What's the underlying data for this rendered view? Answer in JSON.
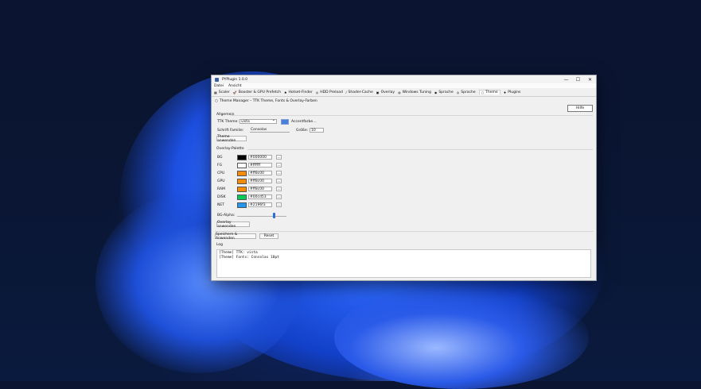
{
  "window": {
    "title": "PYPlugin 1.0.0",
    "buttons": {
      "minimize": "—",
      "maximize": "☐",
      "close": "✕"
    }
  },
  "menubar": [
    "Datei",
    "Ansicht"
  ],
  "tabs": [
    {
      "label": "Scaler",
      "icon": "scaler-icon",
      "glyph": "▦"
    },
    {
      "label": "Booster & GPU Prefetch",
      "icon": "rocket-icon",
      "glyph": "🚀"
    },
    {
      "label": "Hotset-Finder",
      "icon": "flame-icon",
      "glyph": "♠"
    },
    {
      "label": "HDD Preload",
      "icon": "disk-icon",
      "glyph": "◎"
    },
    {
      "label": "Shader-Cache",
      "icon": "slash-icon",
      "glyph": "⁄"
    },
    {
      "label": "Overlay",
      "icon": "overlay-icon",
      "glyph": "▣"
    },
    {
      "label": "Windows Tuning",
      "icon": "globe-icon",
      "glyph": "◍"
    },
    {
      "label": "Sprache",
      "icon": "language-icon",
      "glyph": "◉"
    },
    {
      "label": "Sprache",
      "icon": "globe-small-icon",
      "glyph": "◎"
    },
    {
      "label": "Theme",
      "icon": "theme-icon",
      "glyph": "○"
    },
    {
      "label": "Plugins",
      "icon": "pin-icon",
      "glyph": "♦"
    }
  ],
  "active_tab": "Theme",
  "subheader": {
    "glyph": "○",
    "text": "Theme Manager – TTK Theme, Fonts & Overlay-Farben"
  },
  "help_button": "Hilfe",
  "allgemein": {
    "section": "Allgemein",
    "ttk_label": "TTK Theme:",
    "ttk_value": "vista",
    "accent_button": "Accentfarbe…",
    "accent_color": "#4a7fdc",
    "font_label": "Schrift Familie:",
    "font_value": "Consolas",
    "size_label": "Größe:",
    "size_value": "10",
    "apply_button": "Theme anwenden"
  },
  "palette": {
    "section": "Overlay-Palette",
    "rows": [
      {
        "name": "BG",
        "hex": "#000000",
        "color": "#000000"
      },
      {
        "name": "FG",
        "hex": "#ffffff",
        "color": "#ffffff"
      },
      {
        "name": "CPU",
        "hex": "#ff8c00",
        "color": "#ff8c00"
      },
      {
        "name": "GPU",
        "hex": "#ff8c00",
        "color": "#ff8c00"
      },
      {
        "name": "RAM",
        "hex": "#ff8c00",
        "color": "#ff8c00"
      },
      {
        "name": "DISK",
        "hex": "#00cd53",
        "color": "#00cd53"
      },
      {
        "name": "NET",
        "hex": "#2196f3",
        "color": "#2196f3"
      }
    ],
    "more_glyph": "…",
    "alpha_label": "BG-Alpha:",
    "alpha_value": 0.75,
    "apply_button": "Overlay anwenden"
  },
  "footer": {
    "save_button": "Speichern & Anwenden",
    "reset_button": "Reset"
  },
  "log": {
    "label": "Log",
    "lines": [
      "[Theme] TTK: vista",
      "[Theme] Fonts: Consolas 10pt"
    ]
  }
}
